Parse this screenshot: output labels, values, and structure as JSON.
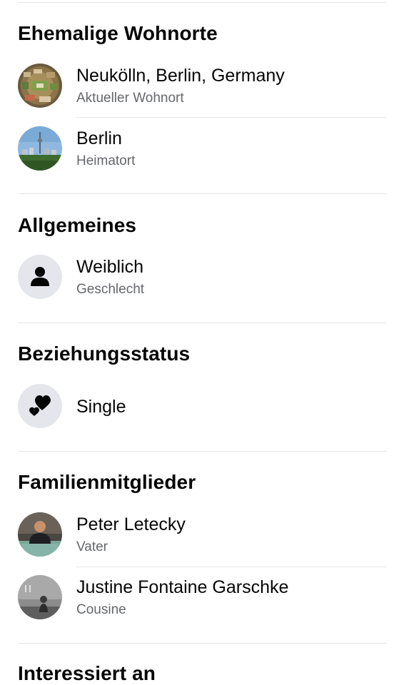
{
  "sections": {
    "residences": {
      "title": "Ehemalige Wohnorte",
      "items": [
        {
          "name": "Neukölln, Berlin, Germany",
          "subtitle": "Aktueller Wohnort",
          "icon": "neukoelln-photo"
        },
        {
          "name": "Berlin",
          "subtitle": "Heimatort",
          "icon": "berlin-skyline-photo"
        }
      ]
    },
    "general": {
      "title": "Allgemeines",
      "items": [
        {
          "name": "Weiblich",
          "subtitle": "Geschlecht",
          "icon": "person-icon"
        }
      ]
    },
    "relationship": {
      "title": "Beziehungsstatus",
      "items": [
        {
          "name": "Single",
          "icon": "hearts-icon"
        }
      ]
    },
    "family": {
      "title": "Familienmitglieder",
      "items": [
        {
          "name": "Peter Letecky",
          "subtitle": "Vater",
          "icon": "profile-photo"
        },
        {
          "name": "Justine Fontaine Garschke",
          "subtitle": "Cousine",
          "icon": "profile-photo"
        }
      ]
    },
    "interested": {
      "title": "Interessiert an"
    }
  },
  "colors": {
    "text_primary": "#050505",
    "text_secondary": "#65676b",
    "divider": "#e4e6eb",
    "icon_background": "#e4e6eb"
  }
}
